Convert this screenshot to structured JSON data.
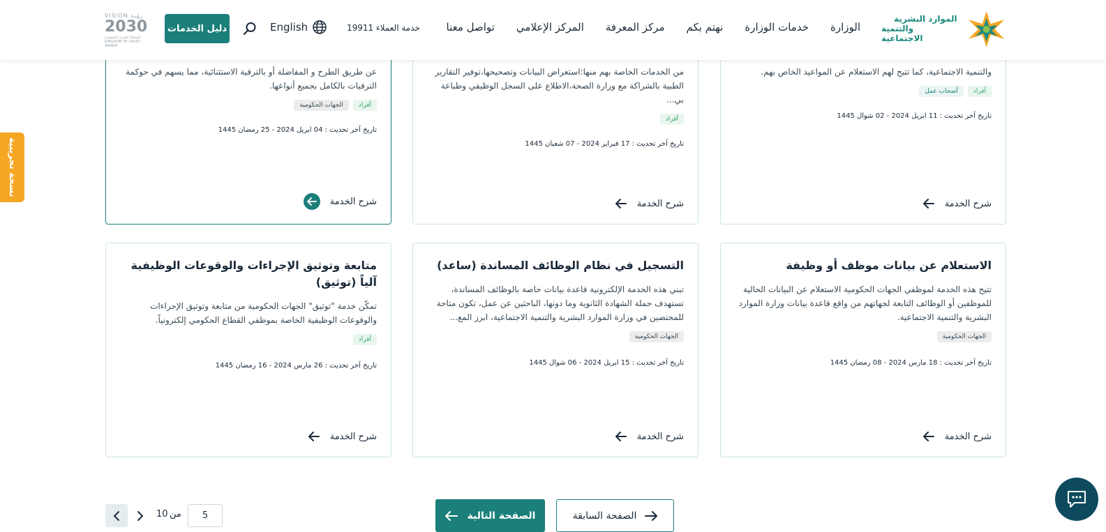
{
  "header": {
    "logo_line1": "الموارد البشرية",
    "logo_line2": "والتنمية الاجتماعية",
    "nav": [
      "الوزارة",
      "خدمات الوزارة",
      "نهتم بكم",
      "مركز المعرفة",
      "المركز الإعلامي",
      "تواصل معنا"
    ],
    "hotline": "خدمة العملاء 19911",
    "language": "English",
    "guide_button": "دليل الخدمات",
    "vision_top": "VISION رؤيـة",
    "vision_year": "2030",
    "vision_sub": "المملكة العربية السعودية KINGDOM OF SAUDI ARABIA"
  },
  "beta_tab": "نسخة تجريبية",
  "explain_label": "شرح الخدمة",
  "cards_top": [
    {
      "desc": "والتنمية الاجتماعية، كما تتيح لهم الاستعلام عن المواعيد الخاص بهم.",
      "tags": [
        "أفراد",
        "أصحاب عمل"
      ],
      "updated": "تاريخ آخر تحديث : 11 ابريل 2024 - 02 شوال 1445"
    },
    {
      "desc": "من الخدمات الخاصة بهم منها:استعراض البيانات وتصحيحها،توفير التقارير الطبية بالشراكة مع وزارة الصحة،الاطلاع على السجل الوظيفي وطباعة بي...",
      "tags": [
        "أفراد"
      ],
      "updated": "تاريخ آخر تحديث : 17 فبراير 2024 - 07 شعبان 1445"
    },
    {
      "desc": "عن طريق الطرح و المفاضلة أو بالترقية الاستثنائية، مما يسهم في حوكمة الترقيات بالكامل بجميع أنواعها.",
      "tags": [
        "أفراد",
        "الجهات الحكومية"
      ],
      "updated": "تاريخ آخر تحديث : 04 ابريل 2024 - 25 رمضان 1445"
    }
  ],
  "cards_bottom": [
    {
      "title": "الاستعلام عن بيانات موظف أو وظيفة",
      "desc": "تتيح هذه الخدمة لموظفي الجهات الحكومية الاستعلام عن البيانات الحالية للموظفين أو الوظائف التابعة لجهاتهم من واقع قاعدة بيانات وزارة الموارد البشرية والتنمية الاجتماعية.",
      "tags": [
        "الجهات الحكومية"
      ],
      "updated": "تاريخ آخر تحديث : 18 مارس 2024 - 08 رمضان 1445"
    },
    {
      "title": "التسجيل في نظام الوظائف المساندة (ساعد)",
      "desc": "تبني هذه الخدمة الإلكترونية قاعدة بيانات خاصة بالوظائف المساندة، تستهدف حملة الشهادة الثانوية وما دونها، الباحثين عن عمل، تكون متاحة للمختصين في وزارة الموارد البشرية والتنمية الاجتماعية، ابرز المع...",
      "tags": [
        "الجهات الحكومية"
      ],
      "updated": "تاريخ آخر تحديث : 15 ابريل 2024 - 06 شوال 1445"
    },
    {
      "title": "متابعة وتوثيق الإجراءات والوقوعات الوظيفية آلياً (توثيق)",
      "desc": "تمكّن خدمة \"توثيق\" الجهات الحكومية من متابعة وتوثيق الإجراءات والوقوعات الوظيفية الخاصة بموظفي القطاع الحكومي إلكترونياً.",
      "tags": [
        "أفراد"
      ],
      "updated": "تاريخ آخر تحديث : 26 مارس 2024 - 16 رمضان 1445"
    }
  ],
  "pagination": {
    "next": "الصفحة التالية",
    "prev": "الصفحة السابقة",
    "current": "5",
    "of": "من",
    "total": "10"
  },
  "colors": {
    "primary": "#1b7f7a",
    "accent": "#f5a623",
    "chat": "#0e4a5e"
  }
}
